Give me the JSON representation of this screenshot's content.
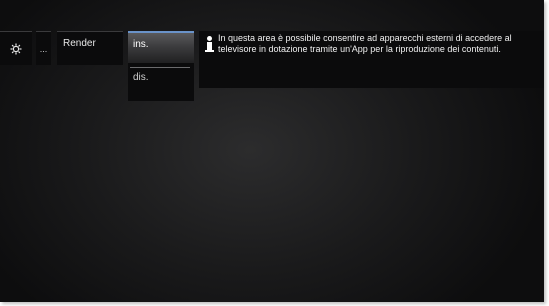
{
  "menu": {
    "ellipsis_label": "...",
    "render_label": "Render",
    "settings_icon": "gear-icon"
  },
  "dropdown": {
    "options": [
      {
        "label": "ins.",
        "selected": true
      },
      {
        "label": "dis.",
        "selected": false
      }
    ]
  },
  "info": {
    "icon": "info-icon",
    "text": "In questa area è possibile consentire ad apparecchi esterni di accedere al televisore in dotazione tramite un'App per la riproduzione dei contenuti."
  },
  "colors": {
    "selection_accent": "#6a93c9",
    "tile_background": "#0b0b0c",
    "screen_background": "#1a1a1b"
  }
}
